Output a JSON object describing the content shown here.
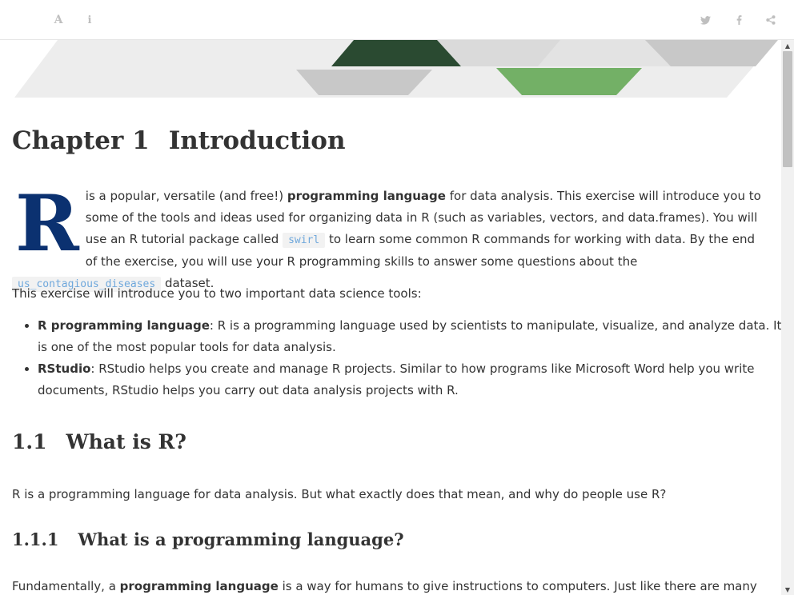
{
  "toolbar": {
    "font_icon": "A",
    "info_icon": "i"
  },
  "chapter": {
    "number": "Chapter 1",
    "title": "Introduction"
  },
  "intro": {
    "dropcap": "R",
    "text_1": " is a popular, versatile (and free!) ",
    "bold_1": "programming language",
    "text_2": " for data analysis. This exercise will introduce you to some of the tools and ideas used for organizing data in R (such as variables, vectors, and data.frames). You will use an R tutorial package called ",
    "code_1": "swirl",
    "text_3": " to learn some common R commands for working with data. By the end of the exercise, you will use your R programming skills to answer some questions about the ",
    "code_2": "us_contagious_diseases",
    "text_4": " dataset."
  },
  "tools_intro": "This exercise will introduce you to two important data science tools:",
  "tools": [
    {
      "term": "R programming language",
      "desc": ": R is a programming language used by scientists to manipulate, visualize, and analyze data. It is one of the most popular tools for data analysis."
    },
    {
      "term": "RStudio",
      "desc": ": RStudio helps you create and manage R projects. Similar to how programs like Microsoft Word help you write documents, RStudio helps you carry out data analysis projects with R."
    }
  ],
  "section_1_1": {
    "number": "1.1",
    "title": "What is R?"
  },
  "what_is_r": "R is a programming language for data analysis. But what exactly does that mean, and why do people use R?",
  "section_1_1_1": {
    "number": "1.1.1",
    "title": "What is a programming language?"
  },
  "fundamentally": {
    "text_1": "Fundamentally, a ",
    "bold_1": "programming language",
    "text_2": " is a way for humans to give instructions to computers. Just like there are many"
  },
  "colors": {
    "dropcap": "#0b3170",
    "code_text": "#6fa8dc",
    "banner_dark_green": "#2a4a31",
    "banner_light_green": "#73b066",
    "banner_gray": "#c8c8c8"
  }
}
